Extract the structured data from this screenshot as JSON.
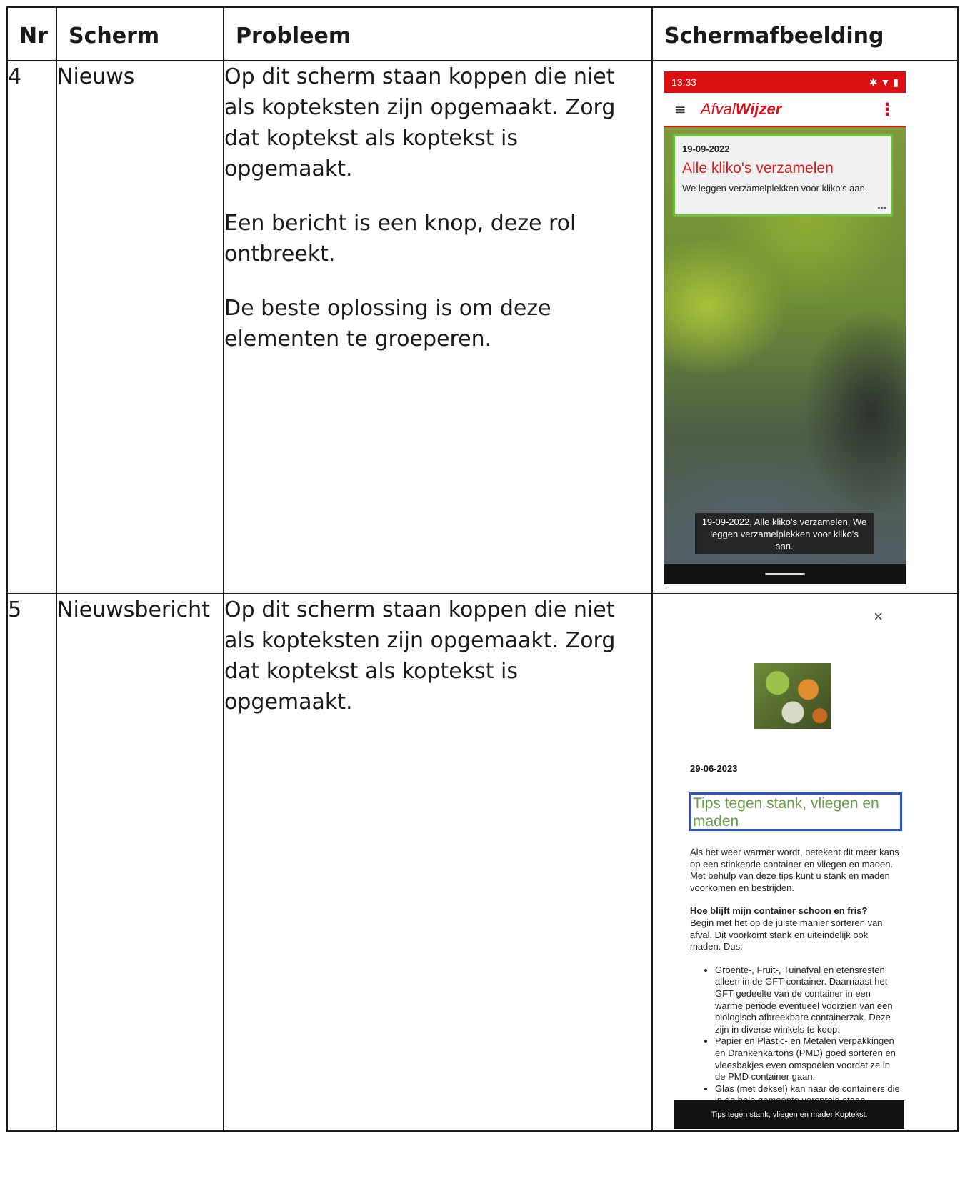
{
  "headers": [
    "Nr",
    "Scherm",
    "Probleem",
    "Schermafbeelding"
  ],
  "rows": [
    {
      "nr": "4",
      "scherm": "Nieuws",
      "probleem": [
        "Op dit scherm staan koppen die niet als kopteksten zijn opgemaakt. Zorg dat koptekst als koptekst is opgemaakt.",
        "Een bericht is een knop, deze rol ontbreekt.",
        "De beste oplossing is om deze elementen te groeperen."
      ],
      "screenshot": {
        "status_time": "13:33",
        "app_logo_part1": "Afval",
        "app_logo_part2": "Wijzer",
        "card": {
          "date": "19-09-2022",
          "title": "Alle kliko's verzamelen",
          "desc": "We leggen verzamelplekken voor kliko's aan."
        },
        "toast": "19-09-2022, Alle kliko's verzamelen, We leggen verzamelplekken voor kliko's aan."
      }
    },
    {
      "nr": "5",
      "scherm": "Nieuwsbericht",
      "probleem": [
        "Op dit scherm staan koppen die niet als kopteksten zijn opgemaakt. Zorg dat koptekst als koptekst is opgemaakt."
      ],
      "screenshot": {
        "close": "×",
        "date": "29-06-2023",
        "title": "Tips tegen stank, vliegen en maden",
        "intro": "Als het weer warmer wordt, betekent dit meer kans op een stinkende container en vliegen en maden. Met behulp van deze tips kunt u stank en maden voorkomen en bestrijden.",
        "subheading": "Hoe blijft mijn container schoon en fris?",
        "subtext": "Begin met het op de juiste manier sorteren van afval. Dit voorkomt stank en uiteindelijk ook maden. Dus:",
        "bullets": [
          "Groente-, Fruit-, Tuinafval en etensresten alleen in de GFT-container. Daarnaast het GFT gedeelte van de container in een warme periode eventueel voorzien van een biologisch afbreekbare containerzak. Deze zijn in diverse winkels te koop.",
          "Papier en Plastic- en Metalen verpakkingen en Drankenkartons (PMD) goed sorteren en vleesbakjes even omspoelen voordat ze in de PMD container gaan.",
          "Glas (met deksel) kan naar de containers die in de hele gemeente verspreid staan."
        ],
        "toast": "Tips tegen stank, vliegen en madenKoptekst."
      }
    }
  ]
}
